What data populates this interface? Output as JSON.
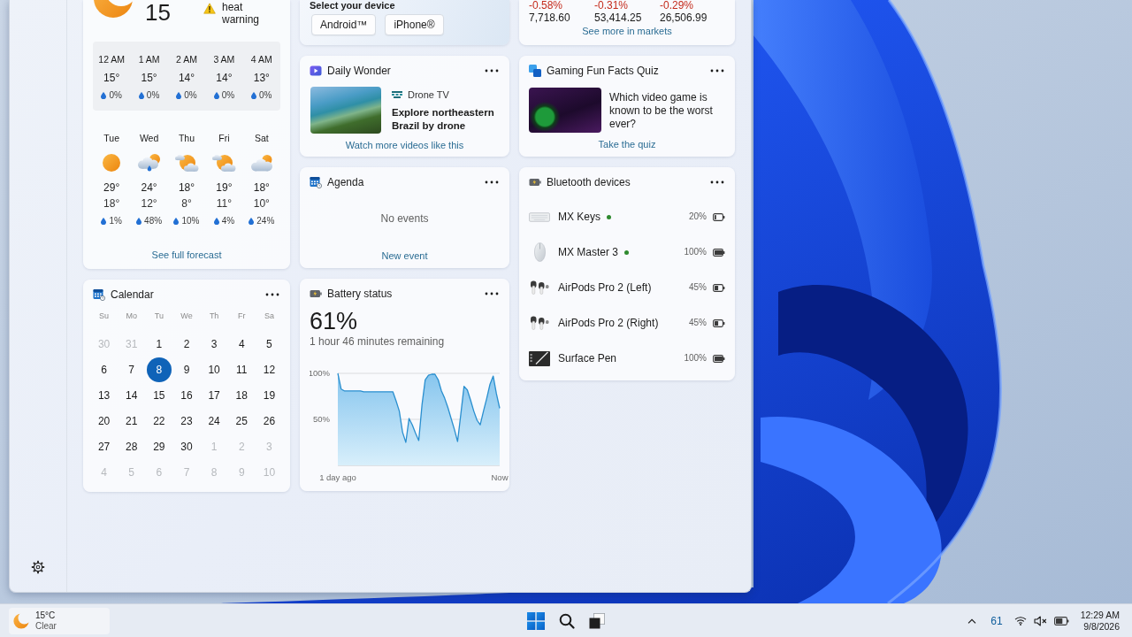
{
  "weather": {
    "temperature": "15",
    "alert": "heat warning",
    "hourly": [
      {
        "time": "12 AM",
        "temp": "15°",
        "precip": "0%"
      },
      {
        "time": "1 AM",
        "temp": "15°",
        "precip": "0%"
      },
      {
        "time": "2 AM",
        "temp": "14°",
        "precip": "0%"
      },
      {
        "time": "3 AM",
        "temp": "14°",
        "precip": "0%"
      },
      {
        "time": "4 AM",
        "temp": "13°",
        "precip": "0%"
      }
    ],
    "daily": [
      {
        "day": "Tue",
        "kind": "sunny",
        "high": "29°",
        "low": "18°",
        "precip": "1%"
      },
      {
        "day": "Wed",
        "kind": "rain",
        "high": "24°",
        "low": "12°",
        "precip": "48%"
      },
      {
        "day": "Thu",
        "kind": "partly_cloudy",
        "high": "18°",
        "low": "8°",
        "precip": "10%"
      },
      {
        "day": "Fri",
        "kind": "partly_cloudy",
        "high": "19°",
        "low": "11°",
        "precip": "4%"
      },
      {
        "day": "Sat",
        "kind": "mostly_cloudy",
        "high": "18°",
        "low": "10°",
        "precip": "24%"
      }
    ],
    "link": "See full forecast"
  },
  "calendar": {
    "title": "Calendar",
    "weekdays": [
      "Su",
      "Mo",
      "Tu",
      "We",
      "Th",
      "Fr",
      "Sa"
    ],
    "weeks": [
      [
        {
          "day": "30",
          "outside_month": true,
          "selected": false
        },
        {
          "day": "31",
          "outside_month": true,
          "selected": false
        },
        {
          "day": "1",
          "outside_month": false,
          "selected": false
        },
        {
          "day": "2",
          "outside_month": false,
          "selected": false
        },
        {
          "day": "3",
          "outside_month": false,
          "selected": false
        },
        {
          "day": "4",
          "outside_month": false,
          "selected": false
        },
        {
          "day": "5",
          "outside_month": false,
          "selected": false
        }
      ],
      [
        {
          "day": "6",
          "outside_month": false,
          "selected": false
        },
        {
          "day": "7",
          "outside_month": false,
          "selected": false
        },
        {
          "day": "8",
          "outside_month": false,
          "selected": true
        },
        {
          "day": "9",
          "outside_month": false,
          "selected": false
        },
        {
          "day": "10",
          "outside_month": false,
          "selected": false
        },
        {
          "day": "11",
          "outside_month": false,
          "selected": false
        },
        {
          "day": "12",
          "outside_month": false,
          "selected": false
        }
      ],
      [
        {
          "day": "13",
          "outside_month": false,
          "selected": false
        },
        {
          "day": "14",
          "outside_month": false,
          "selected": false
        },
        {
          "day": "15",
          "outside_month": false,
          "selected": false
        },
        {
          "day": "16",
          "outside_month": false,
          "selected": false
        },
        {
          "day": "17",
          "outside_month": false,
          "selected": false
        },
        {
          "day": "18",
          "outside_month": false,
          "selected": false
        },
        {
          "day": "19",
          "outside_month": false,
          "selected": false
        }
      ],
      [
        {
          "day": "20",
          "outside_month": false,
          "selected": false
        },
        {
          "day": "21",
          "outside_month": false,
          "selected": false
        },
        {
          "day": "22",
          "outside_month": false,
          "selected": false
        },
        {
          "day": "23",
          "outside_month": false,
          "selected": false
        },
        {
          "day": "24",
          "outside_month": false,
          "selected": false
        },
        {
          "day": "25",
          "outside_month": false,
          "selected": false
        },
        {
          "day": "26",
          "outside_month": false,
          "selected": false
        }
      ],
      [
        {
          "day": "27",
          "outside_month": false,
          "selected": false
        },
        {
          "day": "28",
          "outside_month": false,
          "selected": false
        },
        {
          "day": "29",
          "outside_month": false,
          "selected": false
        },
        {
          "day": "30",
          "outside_month": false,
          "selected": false
        },
        {
          "day": "1",
          "outside_month": true,
          "selected": false
        },
        {
          "day": "2",
          "outside_month": true,
          "selected": false
        },
        {
          "day": "3",
          "outside_month": true,
          "selected": false
        }
      ],
      [
        {
          "day": "4",
          "outside_month": true,
          "selected": false
        },
        {
          "day": "5",
          "outside_month": true,
          "selected": false
        },
        {
          "day": "6",
          "outside_month": true,
          "selected": false
        },
        {
          "day": "7",
          "outside_month": true,
          "selected": false
        },
        {
          "day": "8",
          "outside_month": true,
          "selected": false
        },
        {
          "day": "9",
          "outside_month": true,
          "selected": false
        },
        {
          "day": "10",
          "outside_month": true,
          "selected": false
        }
      ]
    ]
  },
  "device_picker": {
    "heading": "Select your device",
    "buttons": [
      "Android™",
      "iPhone®"
    ]
  },
  "daily_wonder": {
    "title": "Daily Wonder",
    "source": "Drone TV",
    "headline": "Explore northeastern Brazil by drone",
    "link": "Watch more videos like this"
  },
  "agenda": {
    "title": "Agenda",
    "empty_text": "No events",
    "link": "New event"
  },
  "battery_status": {
    "title": "Battery status",
    "percent": "61%",
    "remaining": "1 hour 46 minutes remaining",
    "chart_data": {
      "type": "area",
      "categories": [
        "1 day ago",
        null,
        null,
        null,
        null,
        null,
        null,
        null,
        null,
        null,
        null,
        null,
        null,
        null,
        null,
        null,
        null,
        null,
        null,
        null,
        null,
        null,
        null,
        null,
        null,
        null,
        null,
        null,
        null,
        null,
        null,
        null,
        null,
        null,
        null,
        null,
        null,
        null,
        null,
        null,
        null,
        null,
        null,
        null,
        null,
        null,
        null,
        null,
        null,
        null,
        "Now"
      ],
      "values": [
        100,
        83,
        81,
        81,
        81,
        81,
        81,
        81,
        80,
        80,
        80,
        80,
        80,
        80,
        80,
        80,
        80,
        80,
        70,
        59,
        36,
        25,
        51,
        44,
        35,
        27,
        66,
        93,
        98,
        99,
        99,
        93,
        81,
        73,
        63,
        51,
        39,
        26,
        56,
        86,
        82,
        71,
        59,
        49,
        44,
        59,
        73,
        88,
        97,
        78,
        62
      ],
      "ylim": [
        0,
        100
      ],
      "yticks": [
        {
          "value": 50,
          "label": "50%"
        },
        {
          "value": 100,
          "label": "100%"
        }
      ]
    }
  },
  "markets": {
    "quotes": [
      {
        "change": "-0.58%",
        "value": "7,718.60"
      },
      {
        "change": "-0.31%",
        "value": "53,414.25"
      },
      {
        "change": "-0.29%",
        "value": "26,506.99"
      }
    ],
    "link": "See more in markets"
  },
  "quiz": {
    "title": "Gaming Fun Facts Quiz",
    "question": "Which video game is known to be the worst ever?",
    "link": "Take the quiz"
  },
  "bluetooth": {
    "title": "Bluetooth devices",
    "devices": [
      {
        "name": "MX Keys",
        "kind": "keyboard",
        "connected": true,
        "battery": "20%"
      },
      {
        "name": "MX Master 3",
        "kind": "mouse",
        "connected": true,
        "battery": "100%"
      },
      {
        "name": "AirPods Pro 2 (Left)",
        "kind": "earbuds",
        "connected": false,
        "battery": "45%"
      },
      {
        "name": "AirPods Pro 2 (Right)",
        "kind": "earbuds",
        "connected": false,
        "battery": "45%"
      },
      {
        "name": "Surface Pen",
        "kind": "pen_tablet",
        "connected": false,
        "battery": "100%"
      }
    ]
  },
  "taskbar": {
    "weather": {
      "temperature": "15°C",
      "condition": "Clear"
    },
    "battery_indicator": "61",
    "time": "12:29 AM",
    "date": "9/8/2026"
  }
}
